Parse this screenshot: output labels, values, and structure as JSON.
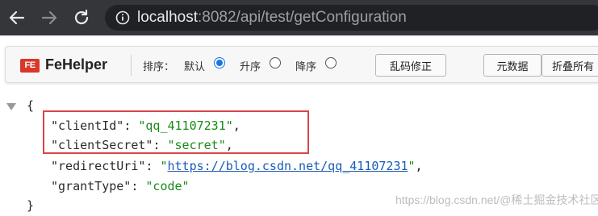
{
  "browser": {
    "url_host": "localhost",
    "url_rest": ":8082/api/test/getConfiguration",
    "icons": {
      "back": "arrow-left-icon",
      "forward": "arrow-right-icon",
      "reload": "reload-icon",
      "info": "info-icon"
    }
  },
  "toolbar": {
    "logo_text": "FE",
    "brand": "FeHelper",
    "sort_label": "排序：",
    "sort_options": [
      {
        "label": "默认",
        "checked": true
      },
      {
        "label": "升序",
        "checked": false
      },
      {
        "label": "降序",
        "checked": false
      }
    ],
    "fix_button": "乱码修正",
    "meta_button": "元数据",
    "fold_button": "折叠所有"
  },
  "json_view": {
    "open_brace": "{",
    "close_brace": "}",
    "entries": [
      {
        "key": "\"clientId\"",
        "value": "\"qq_41107231\"",
        "trail": ","
      },
      {
        "key": "\"clientSecret\"",
        "value": "\"secret\"",
        "trail": ","
      },
      {
        "key": "\"redirectUri\"",
        "quote": "\"",
        "link": "https://blog.csdn.net/qq_41107231",
        "trail": ","
      },
      {
        "key": "\"grantType\"",
        "value": "\"code\"",
        "trail": ""
      }
    ],
    "colon": ": "
  },
  "watermark": "https://blog.csdn.net/@稀土掘金技术社区",
  "colors": {
    "highlight": "#d9454a",
    "string": "#1a8a1a",
    "link": "#1a5ab8"
  }
}
